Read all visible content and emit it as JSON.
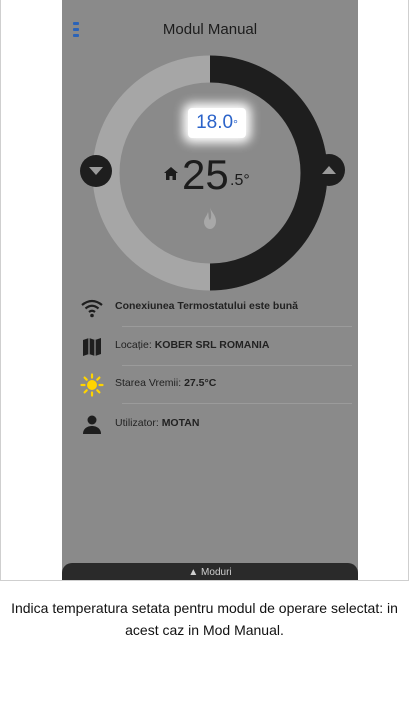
{
  "header": {
    "title": "Modul Manual"
  },
  "thermostat": {
    "setpoint_int": "18.0",
    "setpoint_unit": "°",
    "current_int": "25",
    "current_dec": ".5°",
    "setpoint_value": 18.0,
    "current_value": 25.5
  },
  "info": {
    "connection": {
      "text": "Conexiunea Termostatului este bună"
    },
    "location": {
      "label": "Locație: ",
      "value": "KOBER SRL ROMANIA"
    },
    "weather": {
      "label": "Starea Vremii: ",
      "value": "27.5°C"
    },
    "user": {
      "label": "Utilizator: ",
      "value": "MOTAN"
    }
  },
  "bottom_bar": {
    "label": "▲ Moduri"
  },
  "caption": {
    "text": "Indica temperatura setata pentru modul de operare selectat: in acest caz in Mod Manual."
  },
  "icons": {
    "menu": "hamburger-icon",
    "decrease": "chevron-down-icon",
    "increase": "chevron-up-icon",
    "home": "home-icon",
    "flame": "flame-icon",
    "wifi": "wifi-icon",
    "map": "map-icon",
    "sun": "sun-icon",
    "person": "person-icon"
  },
  "colors": {
    "accent_blue": "#2b63c9",
    "overlay": "#8a8a8a",
    "ring_dark": "#1e1e1e",
    "ring_light": "#a6a6a6",
    "sun": "#ffd400"
  }
}
